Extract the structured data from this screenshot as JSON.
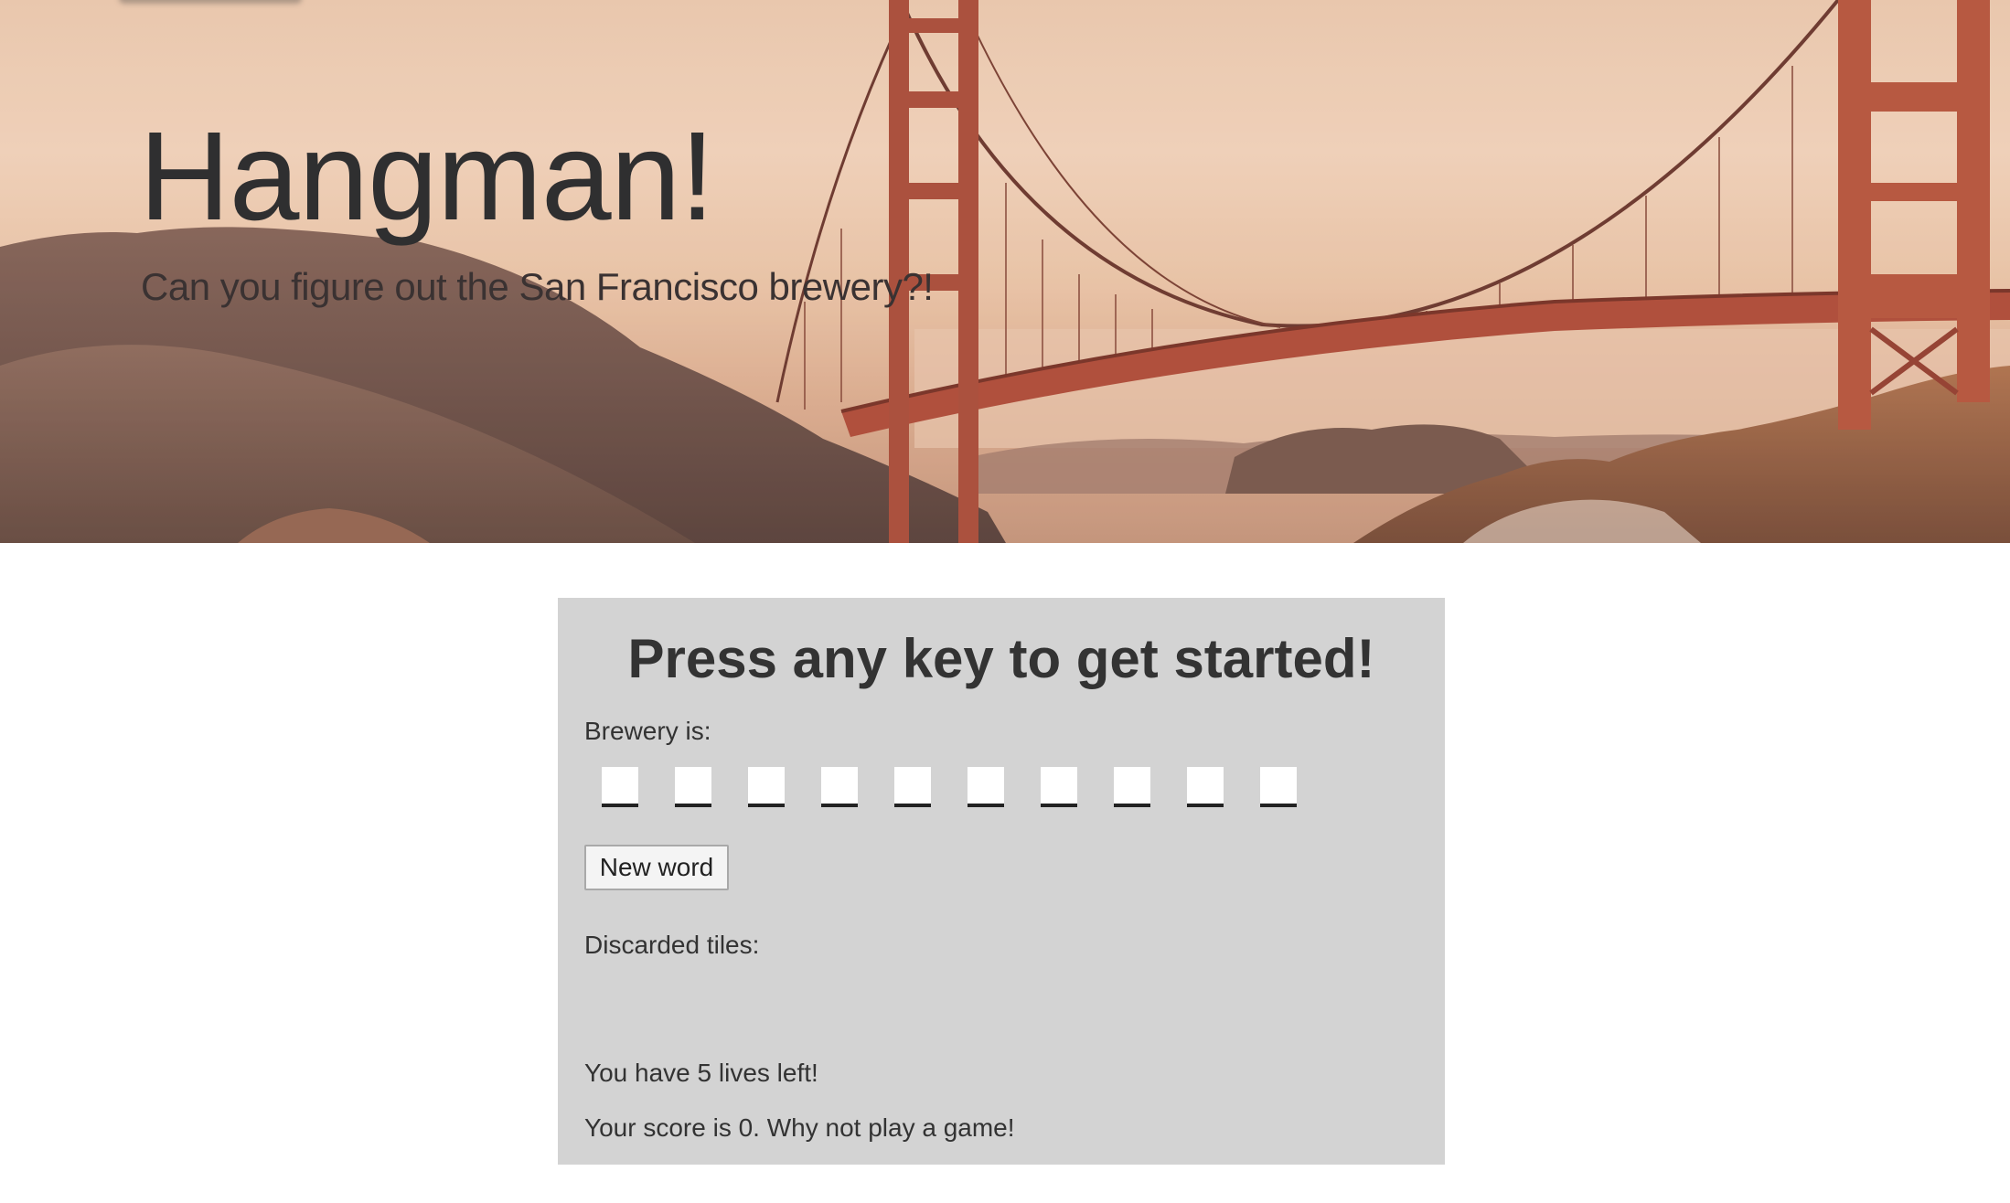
{
  "hero": {
    "title": "Hangman!",
    "subtitle": "Can you figure out the San Francisco brewery?!"
  },
  "game": {
    "prompt": "Press any key to get started!",
    "word_label": "Brewery is:",
    "tiles": [
      "",
      "",
      "",
      "",
      "",
      "",
      "",
      "",
      "",
      ""
    ],
    "new_word_label": "New word",
    "discarded_label": "Discarded tiles:",
    "discarded_letters": "",
    "lives_text": "You have 5 lives left!",
    "score_text": "Your score is 0. Why not play a game!"
  },
  "colors": {
    "panel_background": "#d3d3d3",
    "text": "#333333",
    "bridge": "#a8402e"
  }
}
